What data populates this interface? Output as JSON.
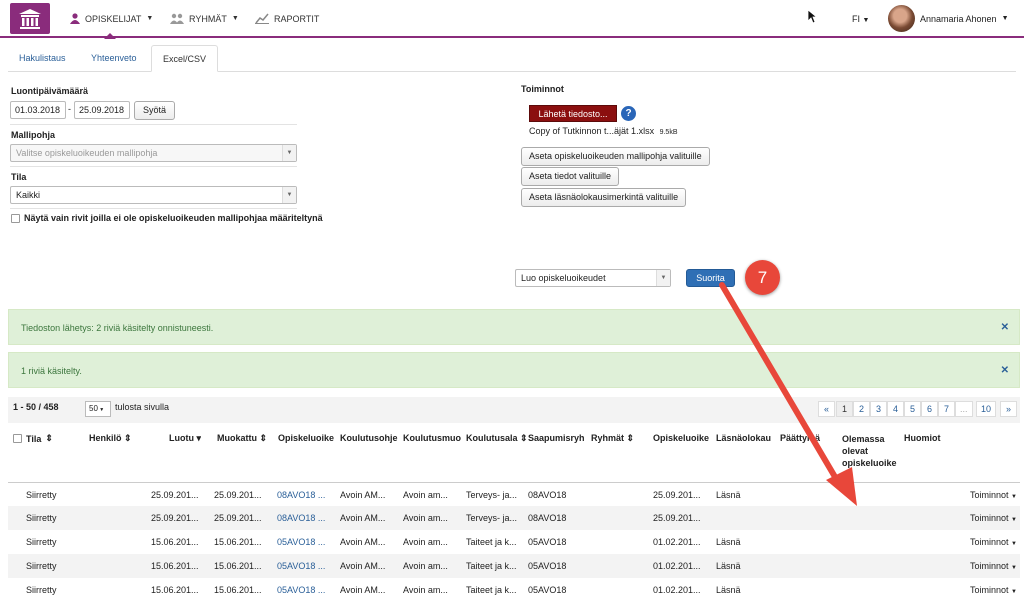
{
  "nav": {
    "items": [
      {
        "label": "OPISKELIJAT",
        "icon": "user-icon"
      },
      {
        "label": "RYHMÄT",
        "icon": "group-icon"
      },
      {
        "label": "RAPORTIT",
        "icon": "chart-icon"
      }
    ],
    "lang": "FI",
    "user": "Annamaria Ahonen"
  },
  "tabs": [
    "Hakulistaus",
    "Yhteenveto",
    "Excel/CSV"
  ],
  "form": {
    "date_label": "Luontipäivämäärä",
    "date_from": "01.03.2018",
    "date_to": "25.09.2018",
    "date_button": "Syötä",
    "template_label": "Mallipohja",
    "template_placeholder": "Valitse opiskeluoikeuden mallipohja",
    "state_label": "Tila",
    "state_value": "Kaikki",
    "checkbox_label": "Näytä vain rivit joilla ei ole opiskeluoikeuden mallipohjaa määriteltynä"
  },
  "actions": {
    "title": "Toiminnot",
    "send_button": "Lähetä tiedosto...",
    "file_name": "Copy of Tutkinnon t...äjät 1.xlsx",
    "file_size": "9.5kB",
    "buttons": [
      "Aseta opiskeluoikeuden mallipohja valituille",
      "Aseta tiedot valituille",
      "Aseta läsnäolokausimerkintä valituille"
    ],
    "bulk_select": "Luo opiskeluoikeudet",
    "run_button": "Suorita",
    "step_number": "7"
  },
  "alerts": [
    "Tiedoston lähetys: 2 riviä käsitelty onnistuneesti.",
    "1 riviä käsitelty."
  ],
  "pager": {
    "summary": "1 - 50 / 458",
    "per_page": "50",
    "per_page_label": "tulosta sivulla",
    "pages": [
      "«",
      "1",
      "2",
      "3",
      "4",
      "5",
      "6",
      "7",
      "...",
      "10",
      "»"
    ]
  },
  "table": {
    "headers": [
      "Tila",
      "Henkilö",
      "Luotu",
      "Muokattu",
      "Opiskeluoike",
      "Koulutusohje",
      "Koulutusmuo",
      "Koulutusala",
      "Saapumisryh",
      "Ryhmät",
      "Opiskeluoike",
      "Läsnäolokau",
      "Päättymä",
      "Olemassa olevat opiskeluoike",
      "Huomiot"
    ],
    "rows": [
      {
        "tila": "Siirretty",
        "luotu": "25.09.201...",
        "muokattu": "25.09.201...",
        "oo": "08AVO18 ...",
        "ohj": "Avoin AM...",
        "muoto": "Avoin am...",
        "ala": "Terveys- ja...",
        "saap": "08AVO18",
        "oo2": "25.09.201...",
        "lasna": "Läsnä",
        "action": "Toiminnot"
      },
      {
        "tila": "Siirretty",
        "luotu": "25.09.201...",
        "muokattu": "25.09.201...",
        "oo": "08AVO18 ...",
        "ohj": "Avoin AM...",
        "muoto": "Avoin am...",
        "ala": "Terveys- ja...",
        "saap": "08AVO18",
        "oo2": "25.09.201...",
        "lasna": "",
        "action": "Toiminnot"
      },
      {
        "tila": "Siirretty",
        "luotu": "15.06.201...",
        "muokattu": "15.06.201...",
        "oo": "05AVO18 ...",
        "ohj": "Avoin AM...",
        "muoto": "Avoin am...",
        "ala": "Taiteet ja k...",
        "saap": "05AVO18",
        "oo2": "01.02.201...",
        "lasna": "Läsnä",
        "action": "Toiminnot"
      },
      {
        "tila": "Siirretty",
        "luotu": "15.06.201...",
        "muokattu": "15.06.201...",
        "oo": "05AVO18 ...",
        "ohj": "Avoin AM...",
        "muoto": "Avoin am...",
        "ala": "Taiteet ja k...",
        "saap": "05AVO18",
        "oo2": "01.02.201...",
        "lasna": "Läsnä",
        "action": "Toiminnot"
      },
      {
        "tila": "Siirretty",
        "luotu": "15.06.201...",
        "muokattu": "15.06.201...",
        "oo": "05AVO18 ...",
        "ohj": "Avoin AM...",
        "muoto": "Avoin am...",
        "ala": "Taiteet ja k...",
        "saap": "05AVO18",
        "oo2": "01.02.201...",
        "lasna": "Läsnä",
        "action": "Toiminnot"
      }
    ]
  },
  "colors": {
    "brand": "#8a2c7c",
    "primary": "#2f6fb5",
    "danger": "#8b0f0f",
    "success_bg": "#dff0d8",
    "annotation": "#e8473a"
  }
}
